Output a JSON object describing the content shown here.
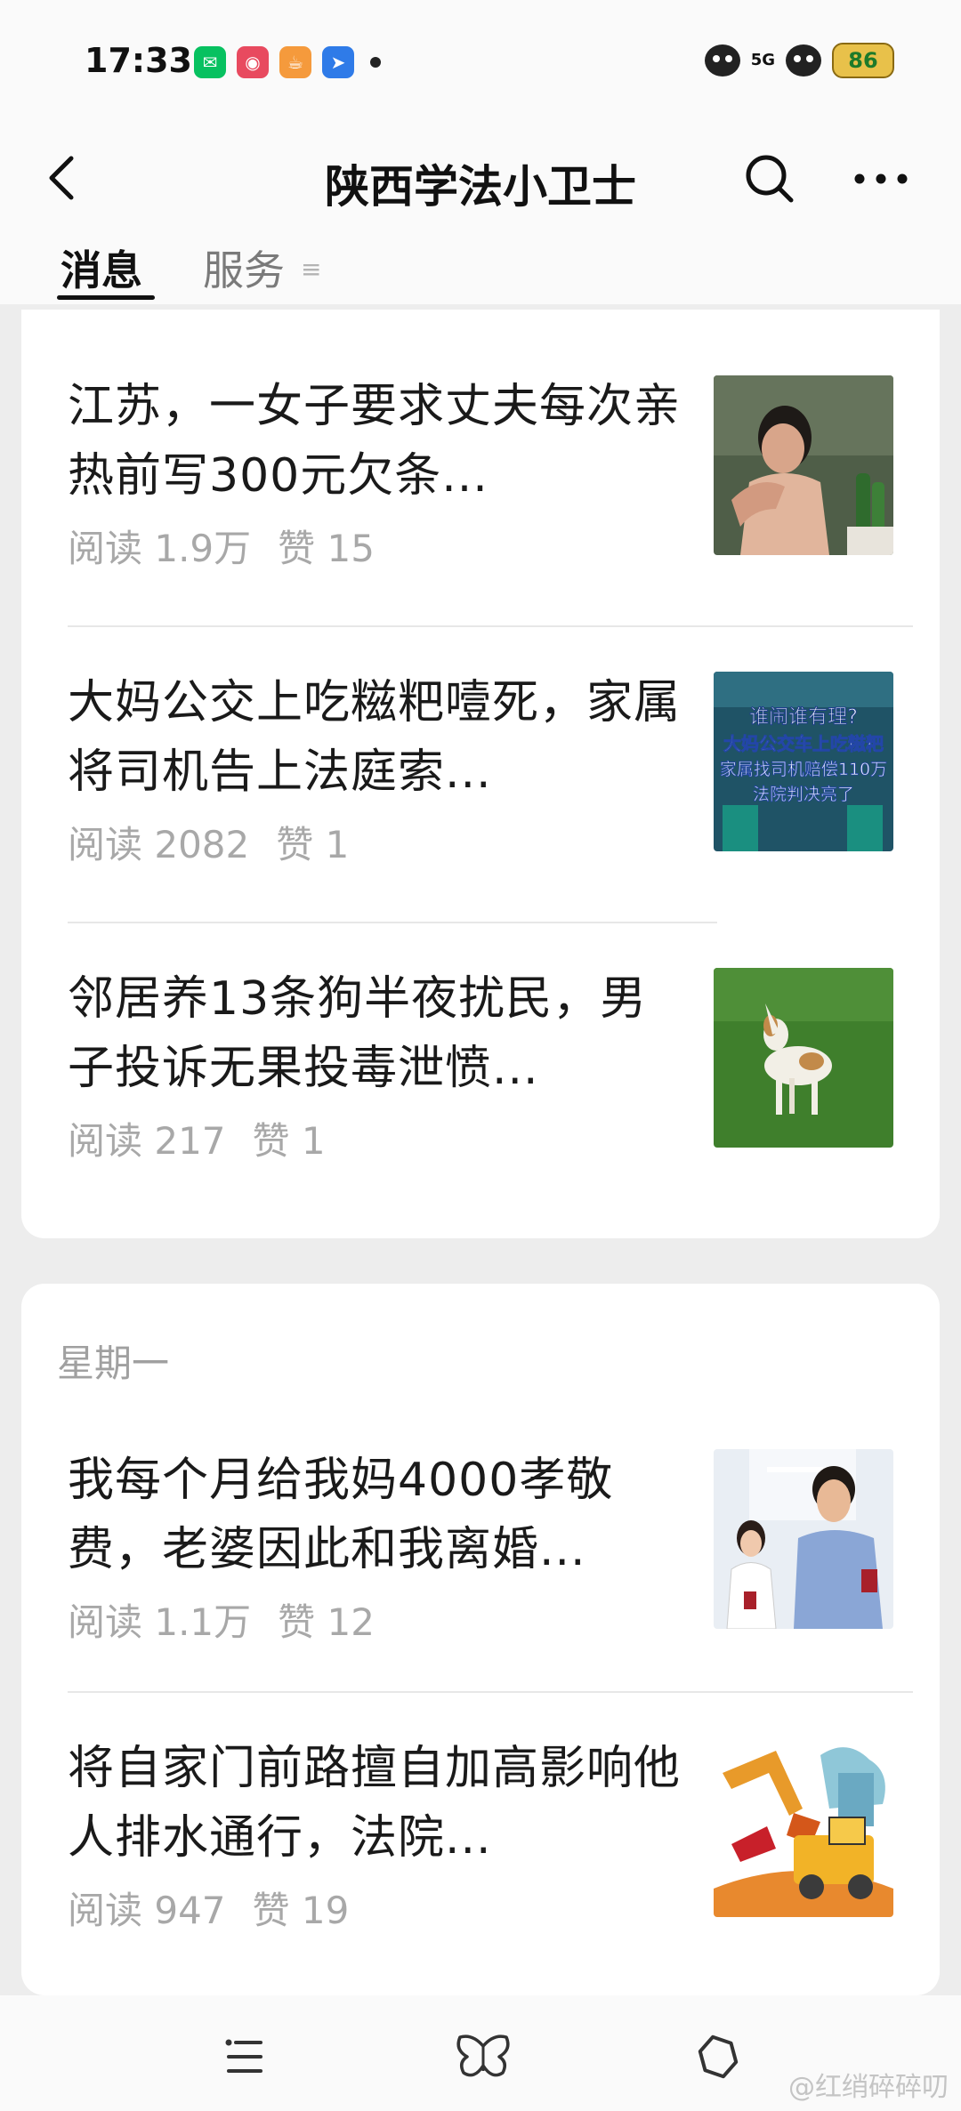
{
  "status": {
    "time": "17:33",
    "network": "5G",
    "battery": "86"
  },
  "header": {
    "title": "陕西学法小卫士"
  },
  "tabs": {
    "messages": "消息",
    "services": "服务"
  },
  "groups": [
    {
      "articles": [
        {
          "title": "江苏，一女子要求丈夫每次亲热前写300元欠条...",
          "reads": "阅读 1.9万",
          "likes": "赞 15"
        },
        {
          "title": "大妈公交上吃糍粑噎死，家属将司机告上法庭索...",
          "reads": "阅读 2082",
          "likes": "赞 1",
          "thumb_text": [
            "谁闹谁有理?",
            "大妈公交车上吃糍粑",
            "家属找司机赔偿110万",
            "法院判决亮了"
          ]
        },
        {
          "title": "邻居养13条狗半夜扰民，男子投诉无果投毒泄愤...",
          "reads": "阅读 217",
          "likes": "赞 1"
        }
      ]
    },
    {
      "day": "星期一",
      "articles": [
        {
          "title": "我每个月给我妈4000孝敬费，老婆因此和我离婚...",
          "reads": "阅读 1.1万",
          "likes": "赞 12"
        },
        {
          "title": "将自家门前路擅自加高影响他人排水通行，法院...",
          "reads": "阅读 947",
          "likes": "赞 19"
        }
      ]
    }
  ],
  "watermark": "@红绡碎碎叨",
  "colors": {
    "background": "#ededed",
    "card": "#ffffff",
    "meta_text": "#a8a8a8",
    "wechat_green": "#07c160"
  }
}
